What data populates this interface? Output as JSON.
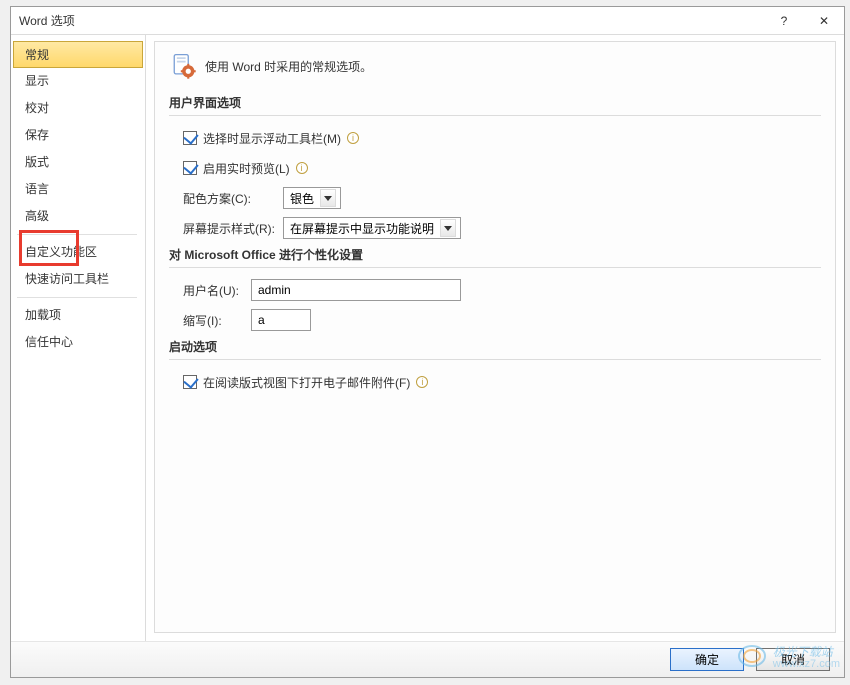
{
  "titlebar": {
    "title": "Word 选项",
    "help": "?",
    "close": "✕"
  },
  "sidebar": {
    "items": [
      {
        "label": "常规",
        "selected": true
      },
      {
        "label": "显示"
      },
      {
        "label": "校对"
      },
      {
        "label": "保存"
      },
      {
        "label": "版式"
      },
      {
        "label": "语言"
      },
      {
        "label": "高级"
      },
      {
        "label": "自定义功能区"
      },
      {
        "label": "快速访问工具栏"
      },
      {
        "label": "加载项"
      },
      {
        "label": "信任中心"
      }
    ]
  },
  "content": {
    "desc": "使用 Word 时采用的常规选项。",
    "section_ui": "用户界面选项",
    "mini_toolbar_label": "选择时显示浮动工具栏(M)",
    "live_preview_label": "启用实时预览(L)",
    "color_scheme_label": "配色方案(C):",
    "color_scheme_value": "银色",
    "screentip_label": "屏幕提示样式(R):",
    "screentip_value": "在屏幕提示中显示功能说明",
    "section_personal": "对 Microsoft Office 进行个性化设置",
    "username_label": "用户名(U):",
    "username_value": "admin",
    "initials_label": "缩写(I):",
    "initials_value": "a",
    "section_startup": "启动选项",
    "reading_view_label": "在阅读版式视图下打开电子邮件附件(F)"
  },
  "footer": {
    "ok": "确定",
    "cancel": "取消"
  },
  "watermark": {
    "main": "极光下载站",
    "sub": "www.xz7.com"
  }
}
